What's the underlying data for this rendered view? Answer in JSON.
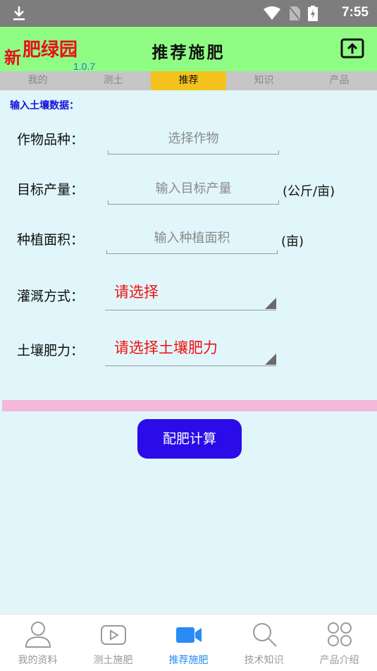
{
  "status_bar": {
    "time": "7:55"
  },
  "header": {
    "logo_a": "新",
    "logo_b": "肥绿园",
    "version": "1.0.7",
    "title": "推荐施肥"
  },
  "tabs": [
    {
      "label": "我的"
    },
    {
      "label": "测土"
    },
    {
      "label": "推荐"
    },
    {
      "label": "知识"
    },
    {
      "label": "产品"
    }
  ],
  "form": {
    "section_label": "输入土壤数据：",
    "crop": {
      "label": "作物品种：",
      "placeholder": "选择作物"
    },
    "target_yield": {
      "label": "目标产量：",
      "placeholder": "输入目标产量",
      "unit": "(公斤/亩)"
    },
    "area": {
      "label": "种植面积：",
      "placeholder": "输入种植面积",
      "unit": "(亩)"
    },
    "irrigation": {
      "label": "灌溉方式：",
      "value": "请选择"
    },
    "fertility": {
      "label": "土壤肥力：",
      "value": "请选择土壤肥力"
    },
    "calc_button": "配肥计算"
  },
  "bottom_nav": [
    {
      "label": "我的资料",
      "icon": "person-icon"
    },
    {
      "label": "测土施肥",
      "icon": "play-icon"
    },
    {
      "label": "推荐施肥",
      "icon": "video-camera-icon"
    },
    {
      "label": "技术知识",
      "icon": "search-icon"
    },
    {
      "label": "产品介绍",
      "icon": "grid-icon"
    }
  ],
  "colors": {
    "header_bg": "#8ffd84",
    "active_tab": "#f3c21d",
    "button": "#2b0be8",
    "active_nav": "#2a8bf2",
    "select_text": "#f01010"
  }
}
